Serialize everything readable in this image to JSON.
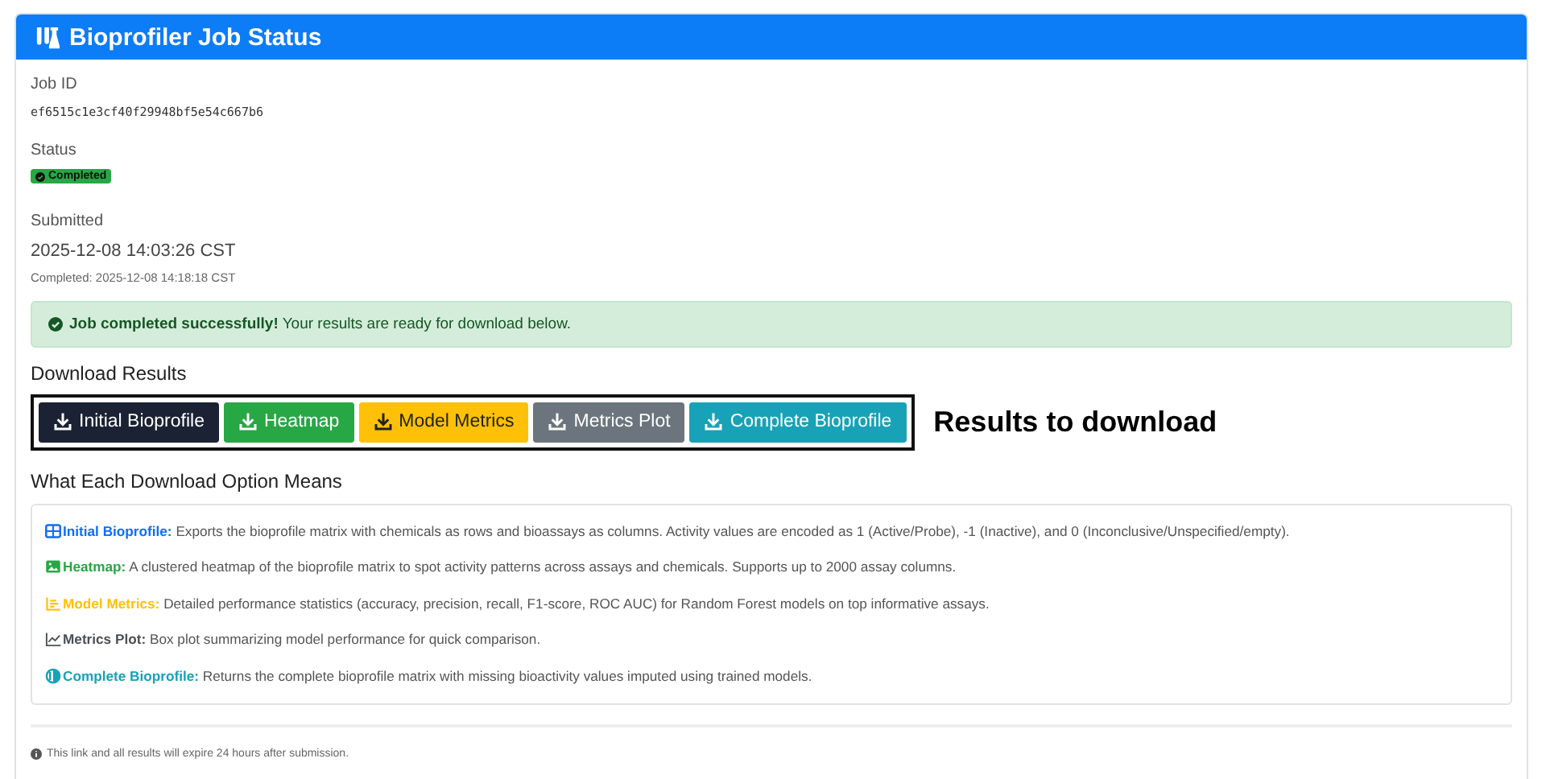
{
  "header": {
    "title": "Bioprofiler Job Status"
  },
  "fields": [
    {
      "label": "Job ID",
      "value": "ef6515c1e3cf40f29948bf5e54c667b6",
      "kind": "mono"
    },
    {
      "label": "Status",
      "value": "Completed",
      "kind": "badge"
    },
    {
      "label": "Submitted",
      "value": "2025-12-08 14:03:26 CST",
      "kind": "plain",
      "note": "Completed: 2025-12-08 14:18:18 CST"
    }
  ],
  "alert": {
    "text": "**Job completed successfully!** Your results are ready for download below."
  },
  "download_title": "Download Results",
  "buttons": [
    {
      "label": "Initial Bioprofile",
      "color": "#1b2233"
    },
    {
      "label": "Heatmap",
      "color": "#28a745"
    },
    {
      "label": "Model Metrics",
      "color": "#ffc107"
    },
    {
      "label": "Metrics Plot",
      "color": "#6c757d"
    },
    {
      "label": "Complete Bioprofile",
      "color": "#17a2b8"
    }
  ],
  "annotation": "Results to download",
  "explain_title": "What Each Download Option Means",
  "explanations": [
    {
      "kind": "table",
      "color": "#0d6efd",
      "title": "Initial Bioprofile:",
      "text": "Exports the bioprofile matrix with chemicals as rows and bioassays as columns. Activity values are encoded as 1 (Active/Probe), -1 (Inactive), and 0 (Inconclusive/Unspecified/empty)."
    },
    {
      "kind": "image",
      "color": "#28a745",
      "title": "Heatmap:",
      "text": "A clustered heatmap of the bioprofile matrix to spot activity patterns across assays and chemicals. Supports up to 2000 assay columns."
    },
    {
      "kind": "bars",
      "color": "#ffc107",
      "title": "Model Metrics:",
      "text": "Detailed performance statistics (accuracy, precision, recall, F1-score, ROC AUC) for Random Forest models on top informative assays."
    },
    {
      "kind": "line",
      "color": "#495057",
      "title": "Metrics Plot:",
      "text": "Box plot summarizing model performance for quick comparison."
    },
    {
      "kind": "half",
      "color": "#17a2b8",
      "title": "Complete Bioprofile:",
      "text": "Returns the complete bioprofile matrix with missing bioactivity values imputed using trained models."
    }
  ],
  "footer": "This link and all results will expire 24 hours after submission."
}
